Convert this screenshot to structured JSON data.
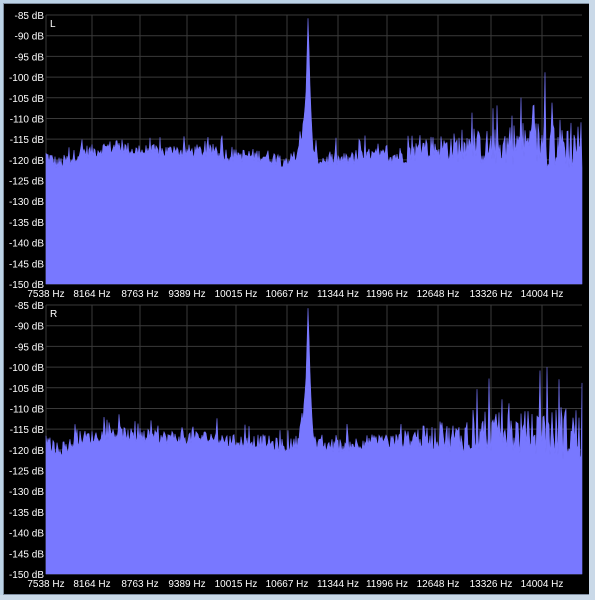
{
  "colors": {
    "background": "#000000",
    "grid": "#3a3a3a",
    "spectrum": "#7878ff",
    "text": "#ffffff"
  },
  "chart_data": [
    {
      "type": "area",
      "channel_label": "L",
      "ylim": [
        -150,
        -85
      ],
      "y_ticks": [
        "-85 dB",
        "-90 dB",
        "-95 dB",
        "-100 dB",
        "-105 dB",
        "-110 dB",
        "-115 dB",
        "-120 dB",
        "-125 dB",
        "-130 dB",
        "-135 dB",
        "-140 dB",
        "-145 dB",
        "-150 dB"
      ],
      "x_ticks": [
        "7538 Hz",
        "8164 Hz",
        "8763 Hz",
        "9389 Hz",
        "10015 Hz",
        "10667 Hz",
        "11344 Hz",
        "11996 Hz",
        "12648 Hz",
        "13326 Hz",
        "14004 Hz"
      ],
      "xlim": [
        7538,
        14700
      ],
      "x": [
        7538,
        7700,
        7850,
        8000,
        8164,
        8350,
        8550,
        8763,
        9000,
        9200,
        9389,
        9600,
        9800,
        10015,
        10250,
        10450,
        10667,
        10800,
        10900,
        10960,
        11010,
        11040,
        11070,
        11100,
        11150,
        11200,
        11344,
        11550,
        11800,
        11996,
        12250,
        12450,
        12648,
        12900,
        13100,
        13326,
        13550,
        13800,
        14004,
        14250,
        14450,
        14700
      ],
      "values": [
        -119,
        -121,
        -120,
        -118,
        -118,
        -117,
        -117,
        -118,
        -118,
        -118,
        -118,
        -118,
        -118,
        -119,
        -119,
        -119,
        -120,
        -120,
        -119,
        -115,
        -105,
        -85,
        -105,
        -116,
        -120,
        -120,
        -120,
        -120,
        -119,
        -119,
        -119,
        -118,
        -117,
        -117,
        -117,
        -117,
        -117,
        -116,
        -116,
        -116,
        -116,
        -116
      ]
    },
    {
      "type": "area",
      "channel_label": "R",
      "ylim": [
        -150,
        -85
      ],
      "y_ticks": [
        "-85 dB",
        "-90 dB",
        "-95 dB",
        "-100 dB",
        "-105 dB",
        "-110 dB",
        "-115 dB",
        "-120 dB",
        "-125 dB",
        "-130 dB",
        "-135 dB",
        "-140 dB",
        "-145 dB",
        "-150 dB"
      ],
      "x_ticks": [
        "7538 Hz",
        "8164 Hz",
        "8763 Hz",
        "9389 Hz",
        "10015 Hz",
        "10667 Hz",
        "11344 Hz",
        "11996 Hz",
        "12648 Hz",
        "13326 Hz",
        "14004 Hz"
      ],
      "xlim": [
        7538,
        14700
      ],
      "x": [
        7538,
        7700,
        7850,
        8000,
        8164,
        8350,
        8550,
        8763,
        9000,
        9200,
        9389,
        9600,
        9800,
        10015,
        10250,
        10450,
        10667,
        10800,
        10900,
        10960,
        11010,
        11040,
        11070,
        11100,
        11150,
        11200,
        11344,
        11550,
        11800,
        11996,
        12250,
        12450,
        12648,
        12900,
        13100,
        13326,
        13550,
        13800,
        14004,
        14250,
        14450,
        14700
      ],
      "values": [
        -118,
        -120,
        -119,
        -117,
        -117,
        -116,
        -116,
        -117,
        -117,
        -117,
        -117,
        -117,
        -117,
        -118,
        -118,
        -118,
        -119,
        -119,
        -118,
        -114,
        -104,
        -85,
        -104,
        -115,
        -119,
        -119,
        -119,
        -119,
        -118,
        -118,
        -118,
        -117,
        -117,
        -117,
        -117,
        -116,
        -116,
        -116,
        -116,
        -116,
        -116,
        -116
      ]
    }
  ]
}
